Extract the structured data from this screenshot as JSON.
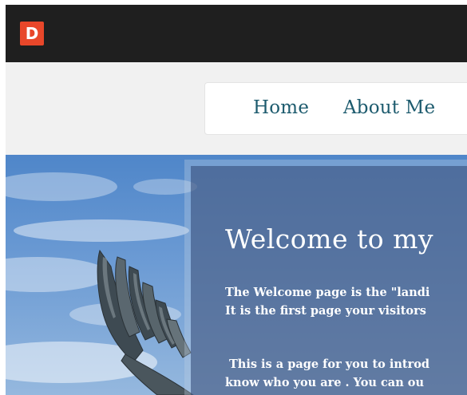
{
  "header": {
    "logo_letter": "D",
    "logo_color": "#e8472a",
    "background_color": "#1f1f1f"
  },
  "nav": {
    "items": [
      {
        "label": "Home"
      },
      {
        "label": "About Me"
      }
    ],
    "link_color": "#1d5b6e"
  },
  "hero": {
    "image_icon": "wing-sculpture-sky-image",
    "title": "Welcome to my",
    "paragraph1_line1": "The Welcome page is the \"landi",
    "paragraph1_line2": "It is the first page your visitors",
    "paragraph2_line1": "This is a page for you to introd",
    "paragraph2_line2": "know who you are . You can ou"
  }
}
